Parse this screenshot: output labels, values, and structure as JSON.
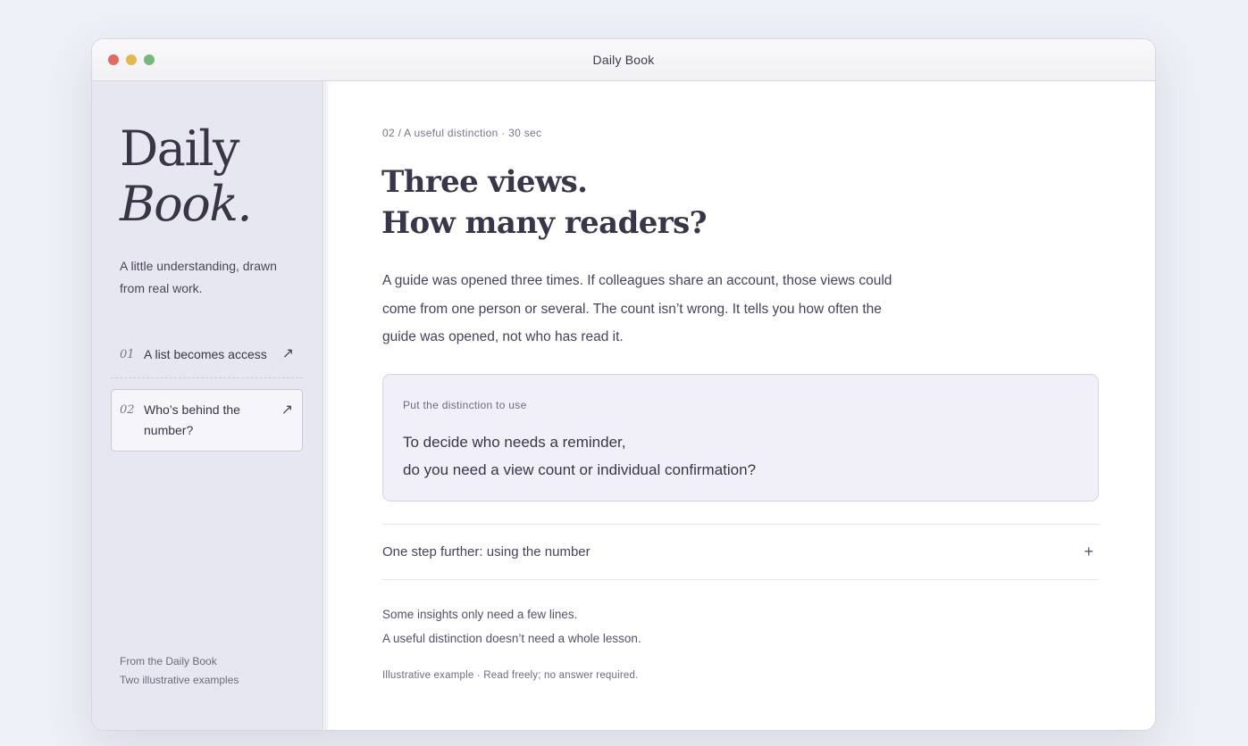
{
  "window": {
    "title": "Daily Book"
  },
  "sidebar": {
    "brand": {
      "line1": "Daily",
      "line2": "Book."
    },
    "tagline": "A little understanding, drawn from real work.",
    "items": [
      {
        "number": "01",
        "label": "A list becomes access",
        "active": false
      },
      {
        "number": "02",
        "label": "Who’s behind the number?",
        "active": true
      }
    ],
    "footer": {
      "line1": "From the Daily Book",
      "line2": "Two illustrative examples"
    }
  },
  "main": {
    "breadcrumb": "02 / A useful distinction · 30 sec",
    "headline": {
      "line1": "Three views.",
      "line2": "How many readers?"
    },
    "lead": "A guide was opened three times. If colleagues share an account, those views could come from one person or several. The count isn’t wrong. It tells you how often the guide was opened, not who has read it.",
    "prompt": {
      "label": "Put the distinction to use",
      "line1": "To decide who needs a reminder,",
      "line2": "do you need a view count or individual confirmation?"
    },
    "expander": {
      "label": "One step further: using the number",
      "icon": "+"
    },
    "outro": {
      "line1": "Some insights only need a few lines.",
      "line2": "A useful distinction doesn’t need a whole lesson."
    },
    "footnote": "Illustrative example · Read freely; no answer required."
  },
  "colors": {
    "sidebar_bg": "#e7e7f1",
    "card_bg": "#f1f0f8",
    "text": "#3a3548",
    "traffic_red": "#e26b60",
    "traffic_yellow": "#e2b74f",
    "traffic_green": "#76b77a"
  },
  "icons": {
    "nav_arrow": "arrow-up-right-icon",
    "expander": "plus-icon"
  }
}
